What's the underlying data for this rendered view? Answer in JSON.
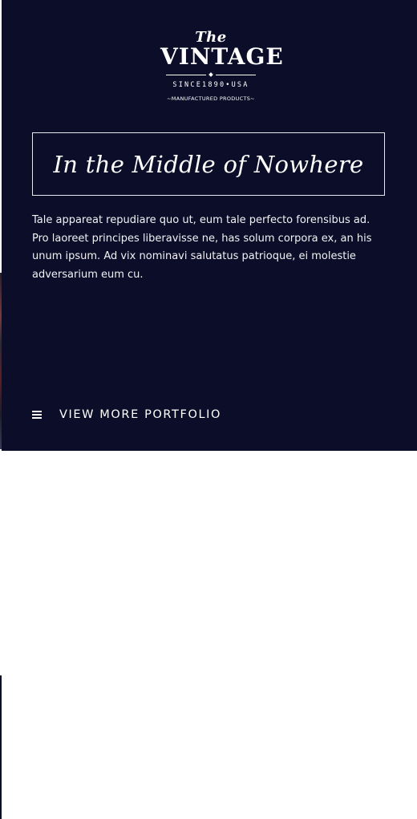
{
  "logo": {
    "the": "The",
    "brand": "VINTAGE",
    "since": "SINCE1890•USA",
    "tagline": "~MANUFACTURED PRODUCTS~"
  },
  "headline": "In the Middle of Nowhere",
  "body": "Tale appareat repudiare quo ut, eum tale perfecto forensibus ad. Pro laoreet principes liberavisse ne, has solum corpora ex, an his unum ipsum. Ad vix nominavi salutatus patrioque, ei molestie adversarium eum cu.",
  "more_link": {
    "icon": "hamburger-menu-icon",
    "label": "VIEW MORE PORTFOLIO"
  },
  "colors": {
    "panel_background": "#0c0e29",
    "text": "#ffffff",
    "page_background": "#ffffff"
  }
}
